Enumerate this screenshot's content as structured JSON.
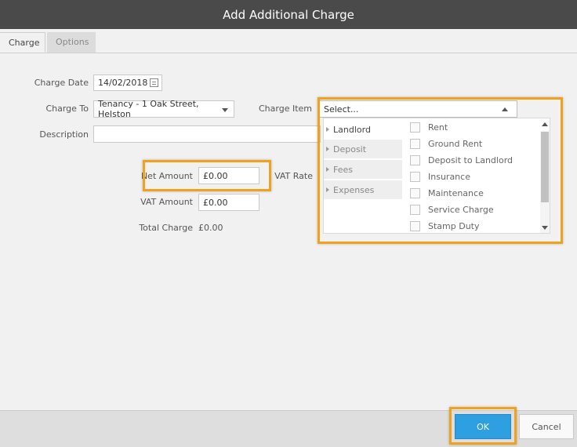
{
  "dialog": {
    "title": "Add Additional Charge"
  },
  "tabs": [
    {
      "label": "Charge"
    },
    {
      "label": "Options"
    }
  ],
  "form": {
    "charge_date_label": "Charge Date",
    "charge_date_value": "14/02/2018",
    "charge_to_label": "Charge To",
    "charge_to_value": "Tenancy - 1 Oak Street, Helston",
    "charge_item_label": "Charge Item",
    "charge_item_value": "Select...",
    "description_label": "Description",
    "description_value": "",
    "net_amount_label": "Net Amount",
    "net_amount_value": "£0.00",
    "vat_rate_label": "VAT Rate",
    "vat_amount_label": "VAT Amount",
    "vat_amount_value": "£0.00",
    "total_charge_label": "Total Charge",
    "total_charge_value": "£0.00"
  },
  "dropdown": {
    "categories": [
      {
        "label": "Landlord Income"
      },
      {
        "label": "Deposit"
      },
      {
        "label": "Fees"
      },
      {
        "label": "Expenses"
      }
    ],
    "items": [
      {
        "label": "Rent"
      },
      {
        "label": "Ground Rent"
      },
      {
        "label": "Deposit to Landlord"
      },
      {
        "label": "Insurance"
      },
      {
        "label": "Maintenance"
      },
      {
        "label": "Service Charge"
      },
      {
        "label": "Stamp Duty"
      }
    ]
  },
  "footer": {
    "ok_label": "OK",
    "cancel_label": "Cancel"
  },
  "colors": {
    "titlebar": "#4a4a4a",
    "highlight": "#f0a21f",
    "ok_button": "#2e9fe0"
  }
}
